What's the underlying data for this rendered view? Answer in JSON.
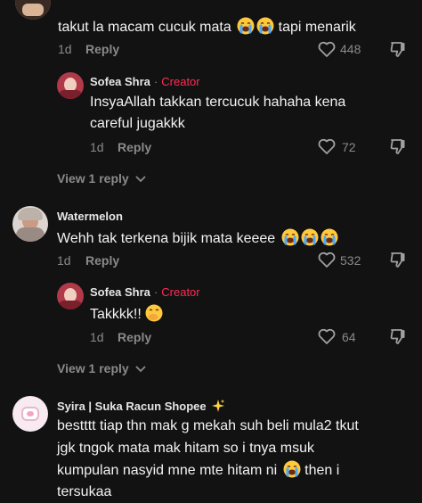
{
  "comments": [
    {
      "text": "takut la macam cucuk mata",
      "text_after": "tapi menarik",
      "emojis": [
        "loudly-crying-face",
        "loudly-crying-face"
      ],
      "date": "1d",
      "reply_label": "Reply",
      "likes": "448",
      "replies": [
        {
          "author": "Sofea Shra",
          "separator": "·",
          "badge": "Creator",
          "text_line1": "InsyaAllah takkan tercucuk hahaha kena",
          "text_line2": "careful jugakkk",
          "date": "1d",
          "reply_label": "Reply",
          "likes": "72"
        }
      ],
      "view_replies_label": "View 1 reply"
    },
    {
      "author": "Watermelon",
      "text": "Wehh tak terkena bijik mata keeee",
      "emojis": [
        "loudly-crying-face",
        "loudly-crying-face",
        "loudly-crying-face"
      ],
      "date": "1d",
      "reply_label": "Reply",
      "likes": "532",
      "replies": [
        {
          "author": "Sofea Shra",
          "separator": "·",
          "badge": "Creator",
          "text": "Takkkk!!",
          "emoji": "face-with-hand-over-mouth",
          "date": "1d",
          "reply_label": "Reply",
          "likes": "64"
        }
      ],
      "view_replies_label": "View 1 reply"
    },
    {
      "author": "Syira | Suka Racun Shopee",
      "author_emoji": "sparkles",
      "text_line1": "bestttt tiap thn mak g mekah suh beli mula2 tkut",
      "text_line2": "jgk tngok mata mak hitam so i tnya msuk",
      "text_line3": "kumpulan nasyid mne mte hitam ni",
      "text_line3_after": "then i",
      "text_line4": "tersukaa",
      "emoji": "loudly-crying-face"
    }
  ],
  "colors": {
    "background": "#121212",
    "creator_badge": "#fe2c55",
    "muted": "#8a8a8a"
  }
}
